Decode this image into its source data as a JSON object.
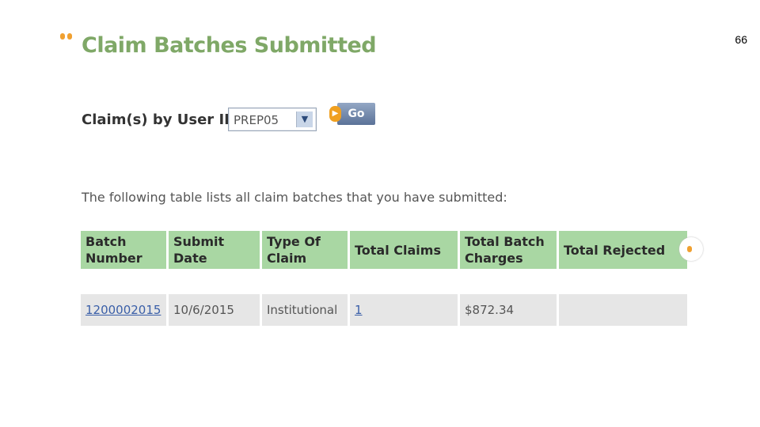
{
  "page_number": "66",
  "page_title": "Claim Batches Submitted",
  "filter": {
    "label": "Claim(s) by User ID:",
    "selected_user": "PREP05",
    "go_label": "Go"
  },
  "intro_text": "The following table lists all claim batches that you have submitted:",
  "table": {
    "columns": [
      "Batch Number",
      "Submit Date",
      "Type Of Claim",
      "Total Claims",
      "Total Batch Charges",
      "Total Rejected"
    ],
    "rows": [
      {
        "batch_number": "1200002015",
        "submit_date": "10/6/2015",
        "type_of_claim": "Institutional",
        "total_claims": "1",
        "total_batch_charges": "$872.34",
        "total_rejected": ""
      }
    ]
  },
  "colors": {
    "title_green": "#7fa867",
    "header_green": "#a9d7a3",
    "accent_orange": "#f0a030",
    "row_gray": "#e6e6e6",
    "link_blue": "#3a5fa8"
  },
  "icons": {
    "title_bullet": "orange-dots-icon",
    "select_arrow": "chevron-down-icon",
    "go_button": "arrow-right-icon"
  }
}
